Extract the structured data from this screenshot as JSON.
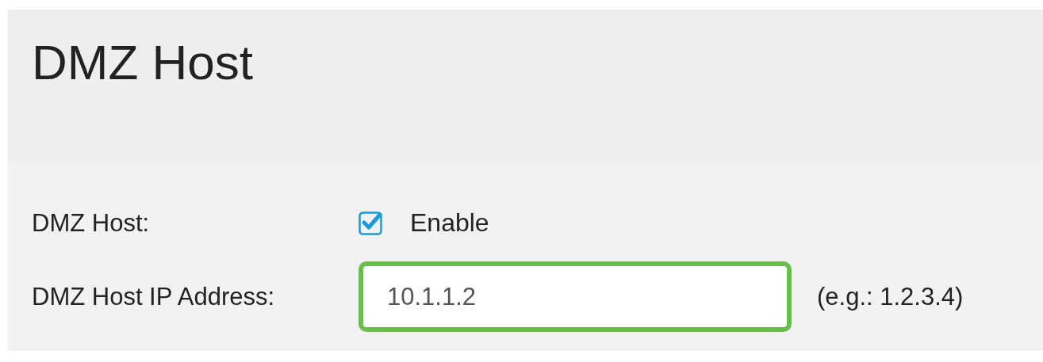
{
  "title": "DMZ Host",
  "dmz_host": {
    "label": "DMZ Host:",
    "checkbox_label": "Enable",
    "checked": true
  },
  "ip_address": {
    "label": "DMZ Host IP Address:",
    "value": "10.1.1.2",
    "focused": true,
    "hint": "(e.g.: 1.2.3.4)"
  }
}
